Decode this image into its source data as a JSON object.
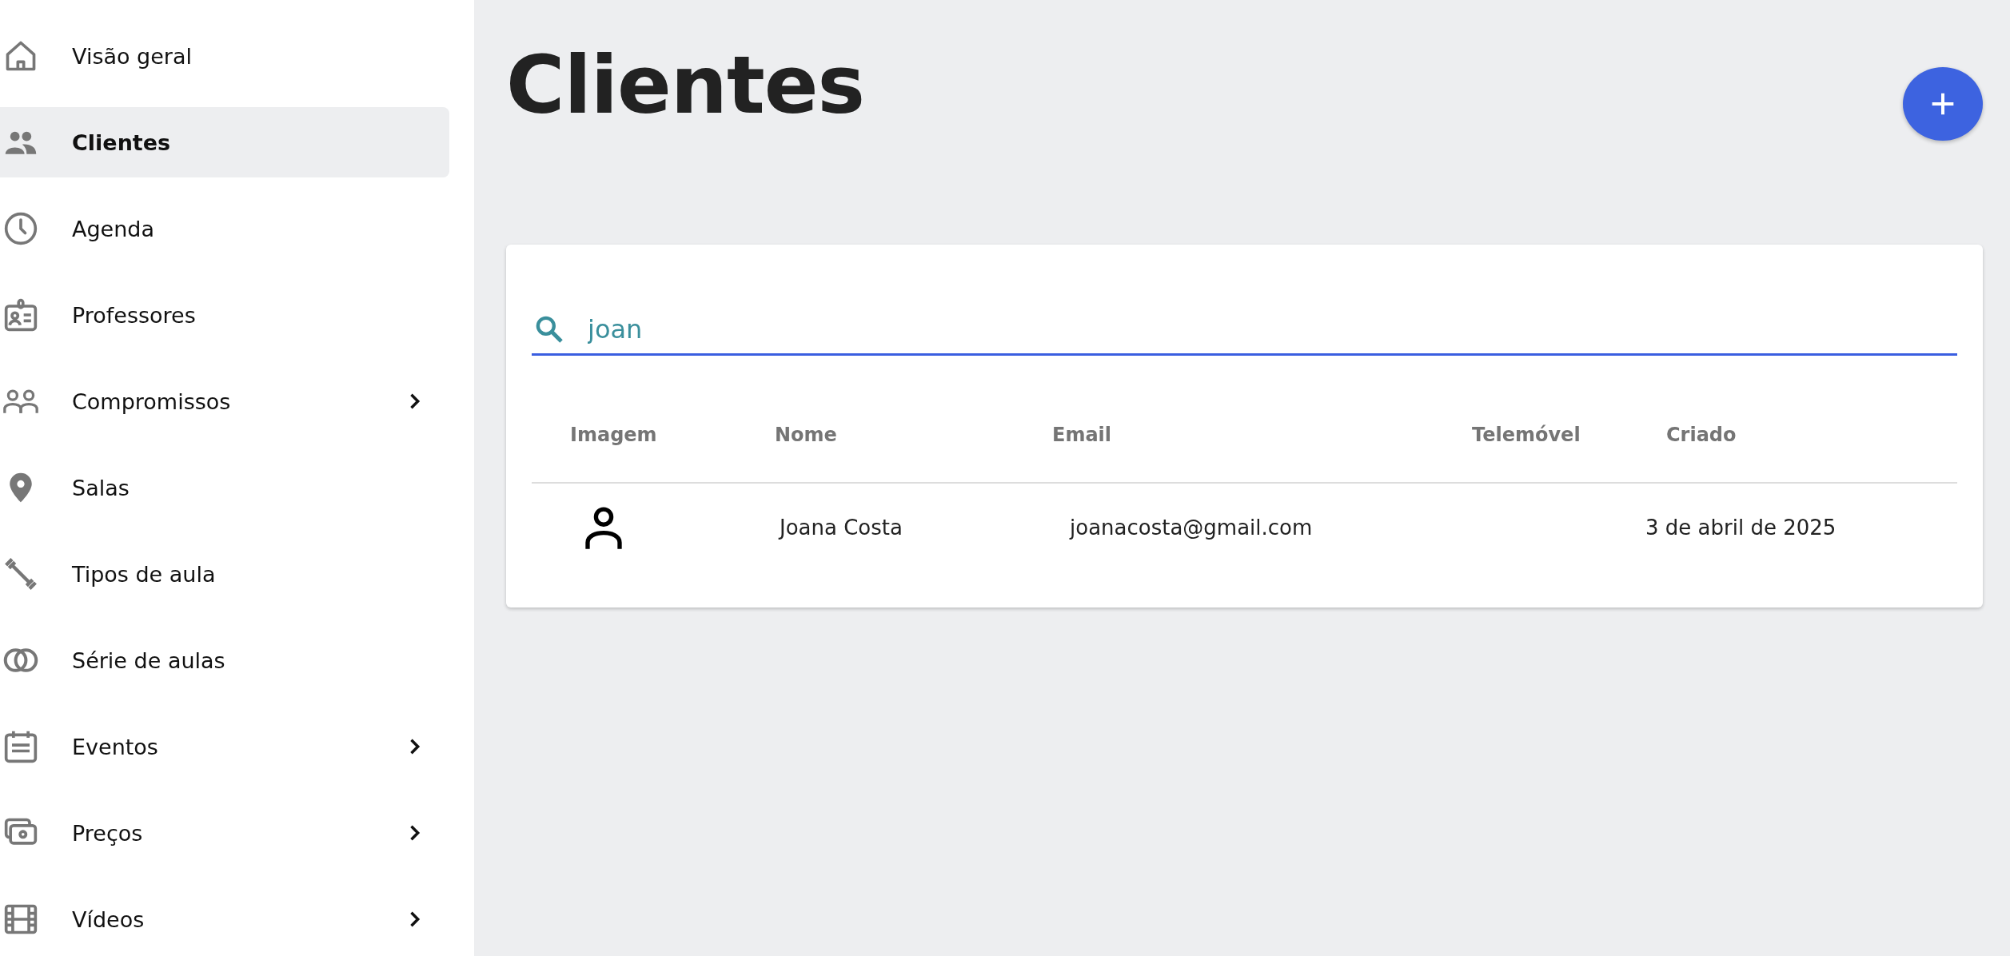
{
  "sidebar": {
    "items": [
      {
        "label": "Visão geral",
        "selected": false,
        "expandable": false
      },
      {
        "label": "Clientes",
        "selected": true,
        "expandable": false
      },
      {
        "label": "Agenda",
        "selected": false,
        "expandable": false
      },
      {
        "label": "Professores",
        "selected": false,
        "expandable": false
      },
      {
        "label": "Compromissos",
        "selected": false,
        "expandable": true
      },
      {
        "label": "Salas",
        "selected": false,
        "expandable": false
      },
      {
        "label": "Tipos de aula",
        "selected": false,
        "expandable": false
      },
      {
        "label": "Série de aulas",
        "selected": false,
        "expandable": false
      },
      {
        "label": "Eventos",
        "selected": false,
        "expandable": true
      },
      {
        "label": "Preços",
        "selected": false,
        "expandable": true
      },
      {
        "label": "Vídeos",
        "selected": false,
        "expandable": true
      }
    ]
  },
  "page": {
    "title": "Clientes"
  },
  "search": {
    "value": "joan"
  },
  "table": {
    "columns": [
      "Imagem",
      "Nome",
      "Email",
      "Telemóvel",
      "Criado"
    ],
    "rows": [
      {
        "nome": "Joana Costa",
        "email": "joanacosta@gmail.com",
        "criado": "3 de abril de 2025"
      }
    ]
  }
}
